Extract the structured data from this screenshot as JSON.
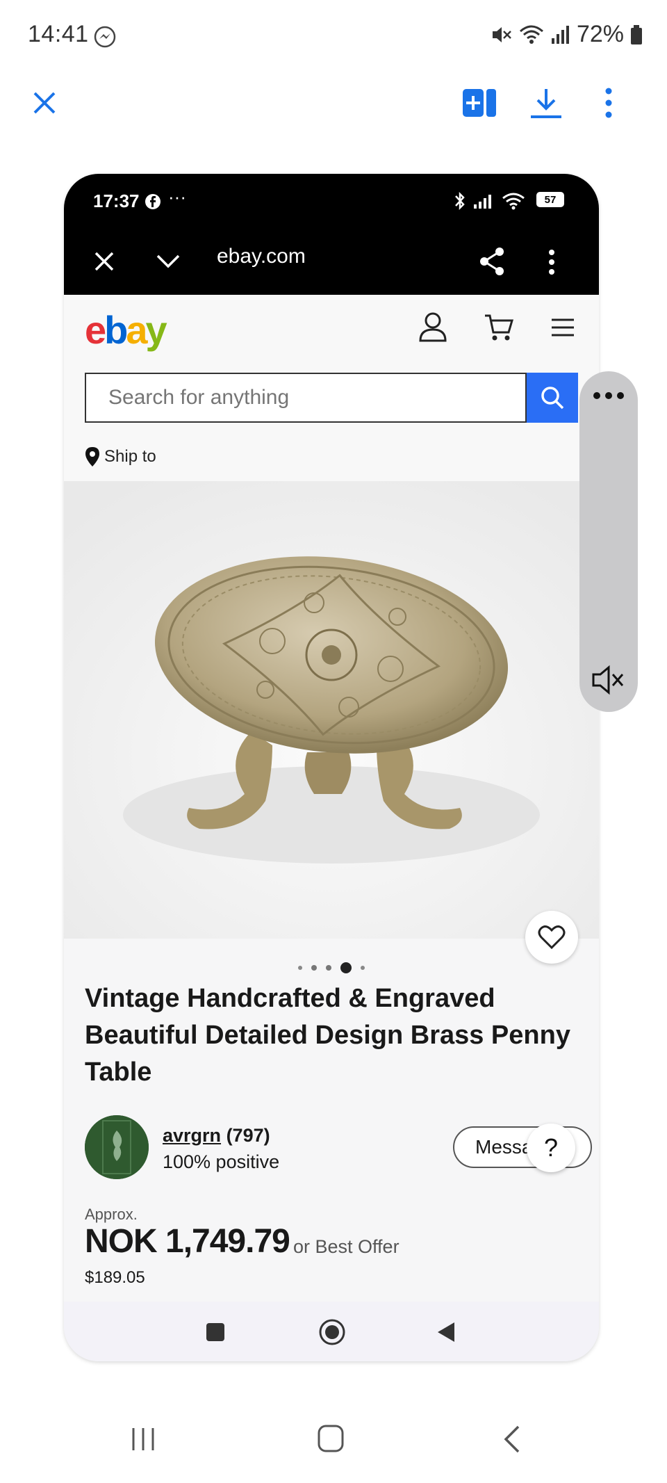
{
  "os_status": {
    "time": "14:41",
    "battery": "72%"
  },
  "phone": {
    "status": {
      "time": "17:37",
      "battery": "57"
    },
    "browser": {
      "url": "ebay.com"
    },
    "ebay": {
      "logo": {
        "e": "e",
        "b": "b",
        "a": "a",
        "y": "y"
      },
      "search_placeholder": "Search for anything",
      "ship_to": "Ship to",
      "product": {
        "title": "Vintage Handcrafted & Engraved Beautiful Detailed Design Brass Penny Table",
        "image_index": 4,
        "image_count": 5
      },
      "seller": {
        "name": "avrgrn",
        "count": "(797)",
        "positive": "100% positive",
        "message_button": "Messa"
      },
      "help_label": "?",
      "price": {
        "approx_label": "Approx.",
        "amount": "NOK 1,749.79",
        "best_offer": "or Best Offer",
        "usd": "$189.05"
      }
    }
  },
  "colors": {
    "accent_blue": "#1a73e8",
    "ebay_red": "#e53238",
    "ebay_blue": "#0064d2",
    "ebay_yellow": "#f5af02",
    "ebay_green": "#86b817",
    "search_blue": "#2a6ef5"
  }
}
